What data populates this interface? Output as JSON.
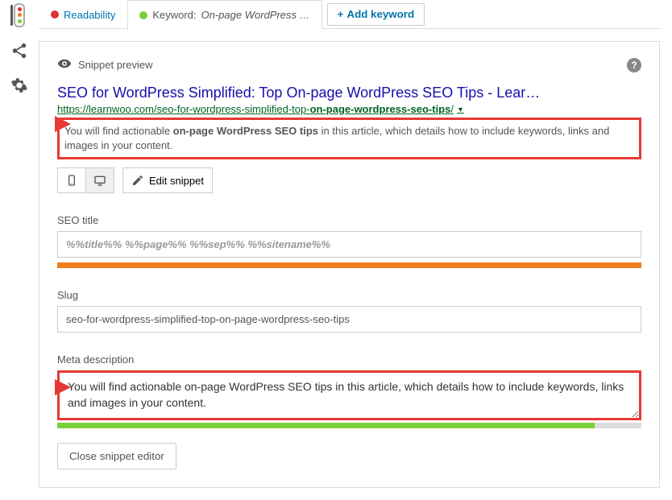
{
  "tabs": {
    "readability": "Readability",
    "keyword_prefix": "Keyword:",
    "keyword_value": "On-page WordPress …",
    "add_keyword": "Add keyword"
  },
  "snippet": {
    "header": "Snippet preview",
    "title": "SEO for WordPress Simplified: Top On-page WordPress SEO Tips - Lear…",
    "url_base": "https://learnwoo.com/seo-for-wordpress-simplified-top-",
    "url_bold": "on-page-wordpress-seo-tips",
    "url_trail": "/",
    "desc_pre": "You will find actionable ",
    "desc_bold": "on-page WordPress SEO tips",
    "desc_post": " in this article, which details how to include keywords, links and images in your content.",
    "edit_label": "Edit snippet"
  },
  "fields": {
    "seo_title_label": "SEO title",
    "seo_title_value": "%%title%% %%page%% %%sep%% %%sitename%%",
    "slug_label": "Slug",
    "slug_value": "seo-for-wordpress-simplified-top-on-page-wordpress-seo-tips",
    "meta_label": "Meta description",
    "meta_value": "You will find actionable on-page WordPress SEO tips in this article, which details how to include keywords, links and images in your content."
  },
  "buttons": {
    "close": "Close snippet editor"
  }
}
